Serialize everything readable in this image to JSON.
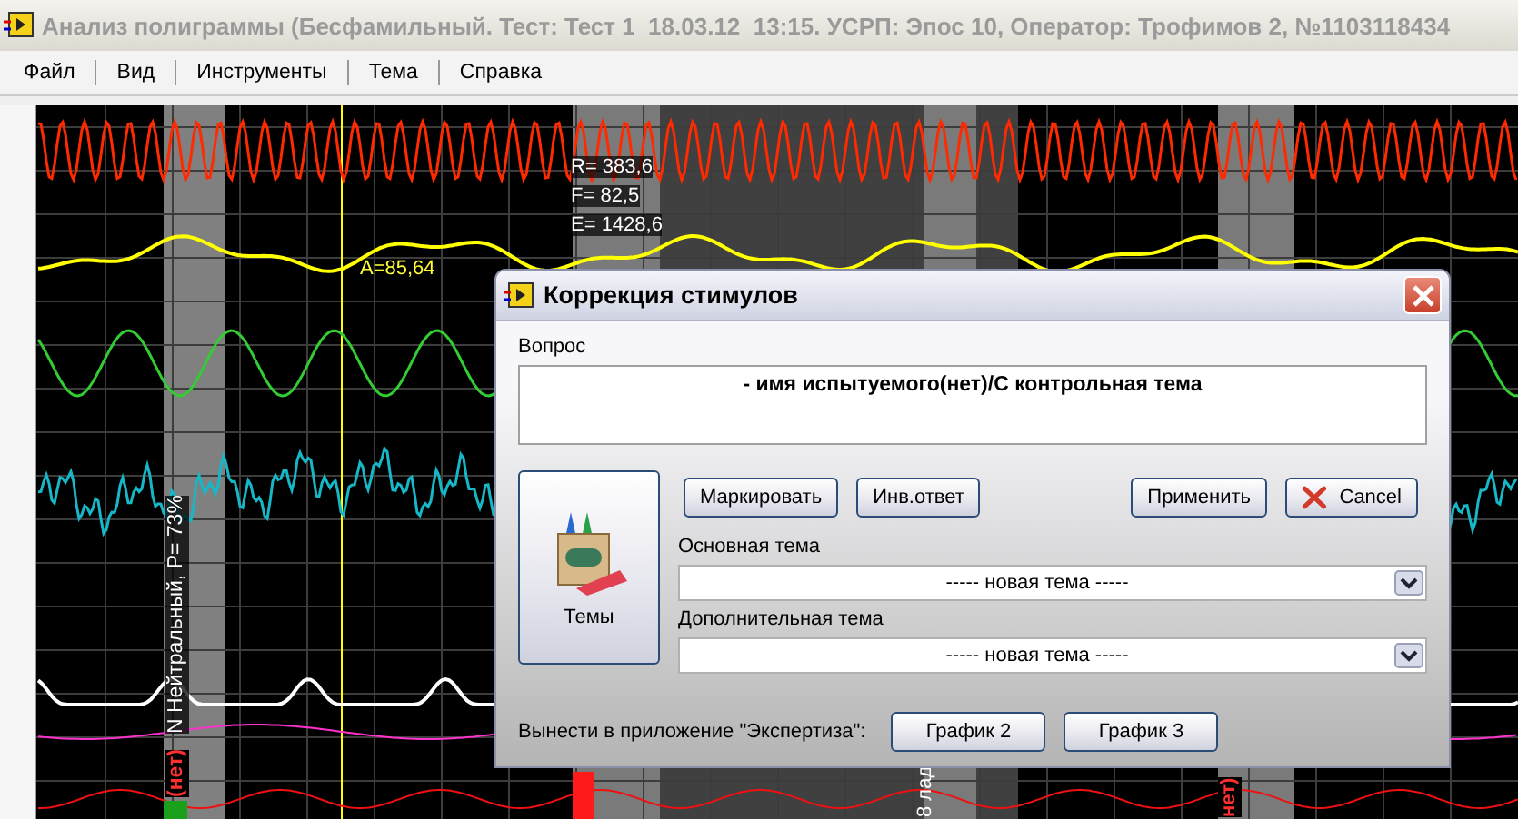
{
  "window": {
    "title": "Анализ полиграммы (Бесфамильный. Тест: Тест 1  18.03.12  13:15. УСРП: Эпос 10, Оператор: Трофимов 2, №1103118434"
  },
  "menu": [
    {
      "label": "Файл"
    },
    {
      "label": "Вид"
    },
    {
      "label": "Инструменты"
    },
    {
      "label": "Тема"
    },
    {
      "label": "Справка"
    }
  ],
  "polygram": {
    "readouts": [
      "R= 383,6",
      "F= 82,5",
      "E= 1428,6"
    ],
    "amplitude_label": "A=85,64",
    "segment_label": {
      "answer": "(нет)",
      "text": "N Нейтральный, P= 73%"
    },
    "fragments": [
      {
        "text": "8 лад",
        "kind": "neutral"
      },
      {
        "text": "нет)",
        "kind": "answer"
      }
    ]
  },
  "dialog": {
    "title": "Коррекция стимулов",
    "question_label": "Вопрос",
    "question": "- имя испытуемого(нет)/С контрольная тема",
    "actions": [
      {
        "label": "Маркировать"
      },
      {
        "label": "Инв.ответ"
      }
    ],
    "apply": "Применить",
    "cancel": "Cancel",
    "themes_button": "Темы",
    "fields": [
      {
        "label": "Основная тема",
        "value": "----- новая тема -----"
      },
      {
        "label": "Дополнительная тема",
        "value": "----- новая тема -----"
      }
    ],
    "export_label": "Вынести в приложение \"Экспертиза\":",
    "export_buttons": [
      {
        "label": "График 2"
      },
      {
        "label": "График 3"
      }
    ]
  }
}
